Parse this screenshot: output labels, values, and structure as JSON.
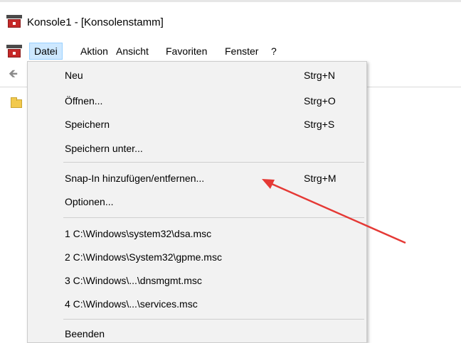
{
  "window": {
    "title": "Konsole1 - [Konsolenstamm]"
  },
  "menubar": {
    "items": [
      {
        "label": "Datei"
      },
      {
        "label": "Aktion"
      },
      {
        "label": "Ansicht"
      },
      {
        "label": "Favoriten"
      },
      {
        "label": "Fenster"
      },
      {
        "label": "?"
      }
    ]
  },
  "file_menu": {
    "items": [
      {
        "label": "Neu",
        "shortcut": "Strg+N"
      },
      {
        "label": "Öffnen...",
        "shortcut": "Strg+O"
      },
      {
        "label": "Speichern",
        "shortcut": "Strg+S"
      },
      {
        "label": "Speichern unter..."
      },
      {
        "label": "Snap-In hinzufügen/entfernen...",
        "shortcut": "Strg+M"
      },
      {
        "label": "Optionen..."
      },
      {
        "label": "1 C:\\Windows\\system32\\dsa.msc"
      },
      {
        "label": "2 C:\\Windows\\System32\\gpme.msc"
      },
      {
        "label": "3 C:\\Windows\\...\\dnsmgmt.msc"
      },
      {
        "label": "4 C:\\Windows\\...\\services.msc"
      },
      {
        "label": "Beenden"
      }
    ]
  },
  "icons": {
    "app": "mmc-console-icon",
    "back": "back-arrow-icon",
    "tree_root": "folder-icon"
  },
  "colors": {
    "menu_active_bg": "#cde8ff",
    "annotation_arrow": "#e53935"
  }
}
